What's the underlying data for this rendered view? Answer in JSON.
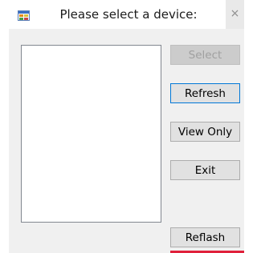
{
  "window": {
    "title": "Please select a device:",
    "icon": "windows-form-icon",
    "close_icon": "close-icon",
    "close_glyph": "×"
  },
  "device_list": {
    "items": []
  },
  "buttons": {
    "select": "Select",
    "refresh": "Refresh",
    "view_only": "View Only",
    "exit": "Exit",
    "reflash": "Reflash"
  },
  "colors": {
    "accent": "#0078d7",
    "status_bar": "#e0203b"
  }
}
